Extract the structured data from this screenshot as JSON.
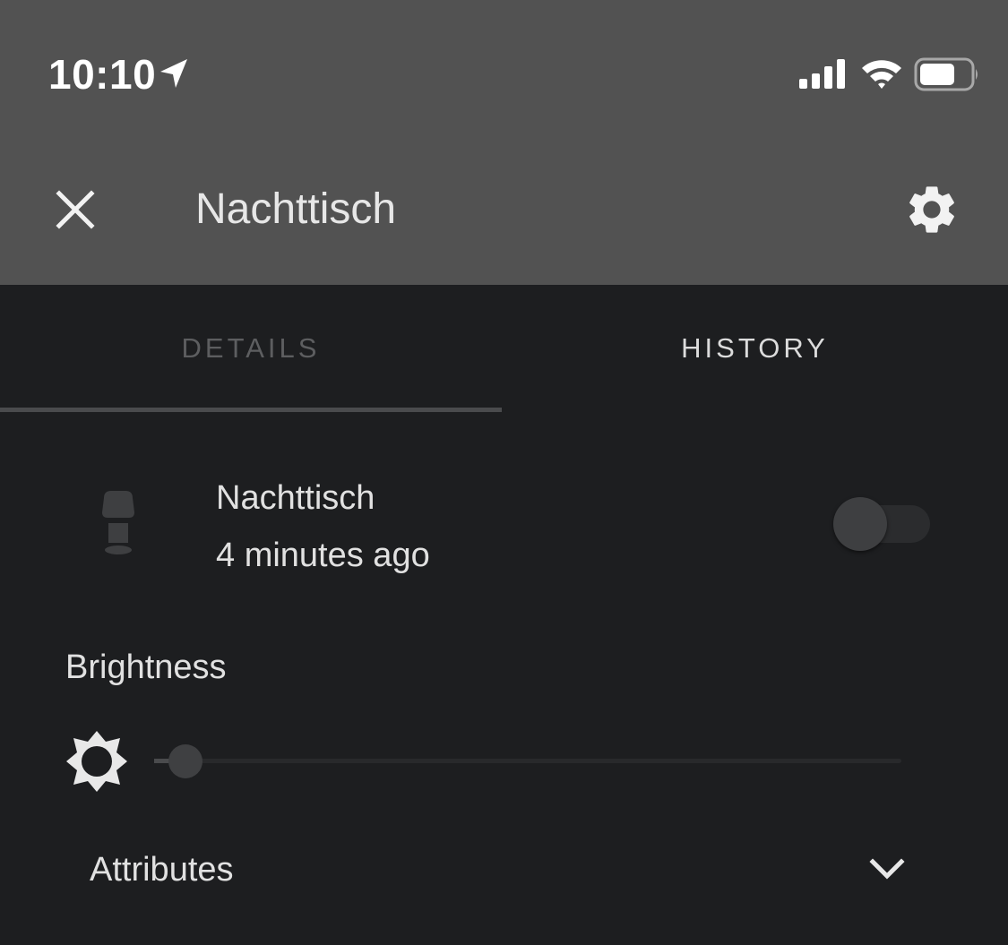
{
  "status_bar": {
    "time": "10:10",
    "icons": [
      "location-arrow-icon",
      "cellular-signal-icon",
      "wifi-icon",
      "battery-icon"
    ]
  },
  "app_bar": {
    "title": "Nachttisch",
    "close_icon": "close-icon",
    "settings_icon": "gear-icon"
  },
  "tabs": [
    {
      "label": "DETAILS",
      "selected": true
    },
    {
      "label": "HISTORY",
      "selected": false
    }
  ],
  "entity": {
    "name": "Nachttisch",
    "last_changed": "4 minutes ago",
    "icon": "lamp-icon",
    "state_on": false
  },
  "brightness": {
    "label": "Brightness",
    "icon": "brightness-icon",
    "value_fraction": 0.02
  },
  "attributes": {
    "label": "Attributes",
    "icon": "chevron-down-icon",
    "expanded": false
  },
  "colors": {
    "header_bg": "#525252",
    "body_bg": "#1d1e20",
    "text": "#e1e1e1",
    "tab_inactive": "#5d5e60",
    "tab_indicator": "#4a4b4d"
  }
}
